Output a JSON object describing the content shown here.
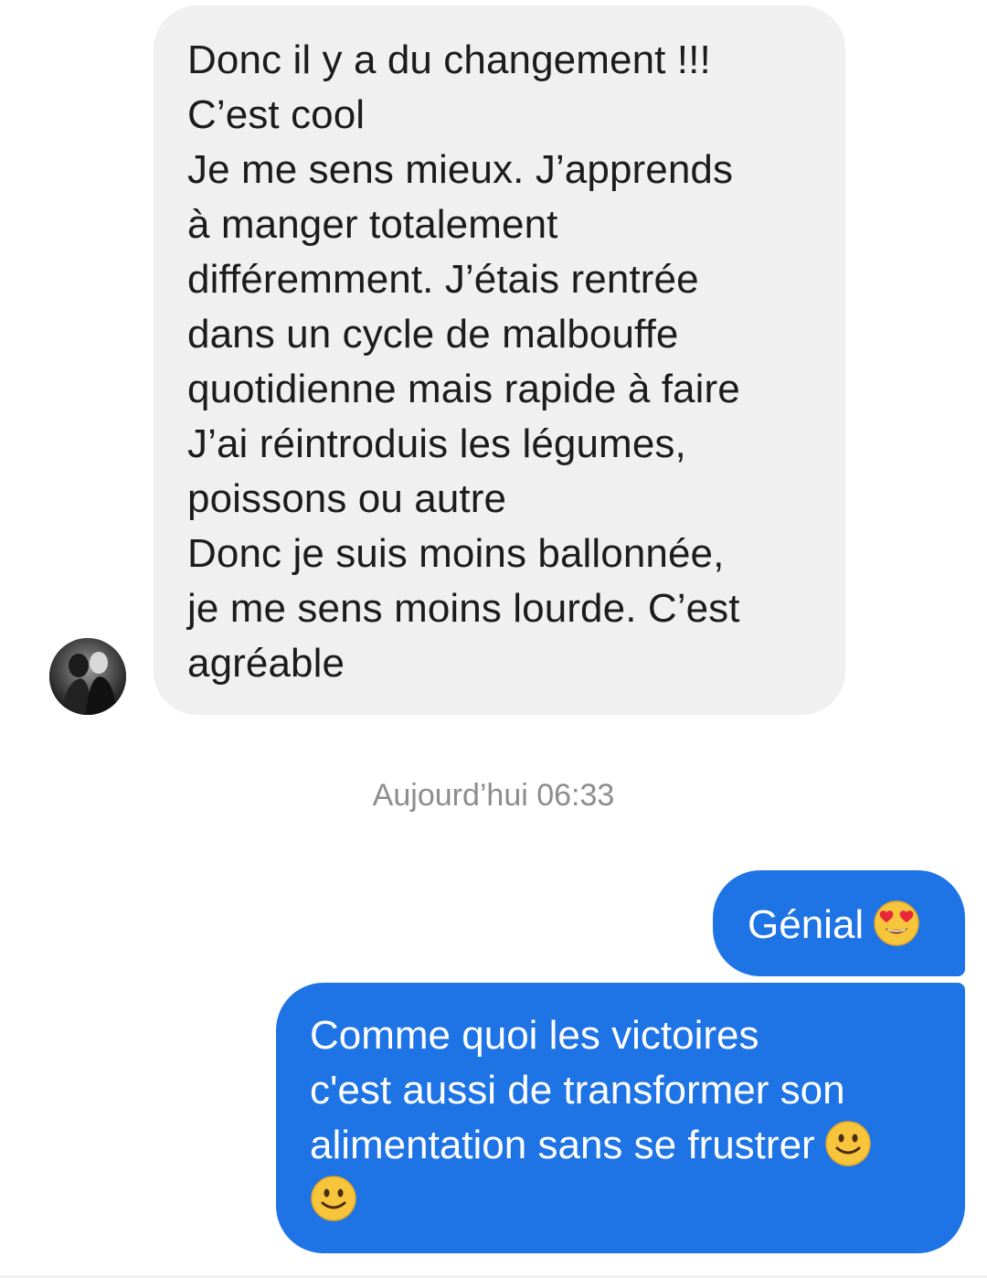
{
  "conversation": {
    "incoming_message": {
      "lines": [
        "Donc il y a du changement !!!",
        "C’est cool",
        "Je me sens mieux. J’apprends",
        "à manger totalement",
        "différemment. J’étais rentrée",
        "dans un cycle de malbouffe",
        "quotidienne mais rapide à faire",
        "J’ai réintroduis les légumes,",
        "poissons ou autre",
        "Donc je suis moins ballonnée,",
        "je me sens moins lourde. C’est",
        "agréable"
      ],
      "avatar_icon": "contact-avatar-photo"
    },
    "timestamp": "Aujourd’hui 06:33",
    "outgoing_messages": [
      {
        "text": "Génial",
        "emoji": "heart-eyes-emoji"
      },
      {
        "lines": [
          "Comme quoi les victoires",
          "c'est aussi de transformer son",
          "alimentation sans se frustrer"
        ],
        "emojis": [
          "slightly-smiling-emoji",
          "slightly-smiling-emoji"
        ]
      }
    ]
  },
  "colors": {
    "incoming_bubble": "#f0f0f0",
    "outgoing_bubble": "#1e74e5",
    "incoming_text": "#1c1c1c",
    "outgoing_text": "#ffffff",
    "timestamp_text": "#8d8d8d"
  }
}
